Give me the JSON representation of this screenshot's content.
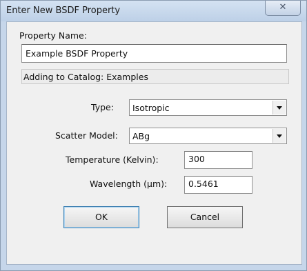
{
  "window": {
    "title": "Enter New BSDF Property",
    "close_glyph": "✕"
  },
  "property_name": {
    "label": "Property Name:",
    "value": "Example BSDF Property"
  },
  "catalog_info": "Adding to Catalog: Examples",
  "type": {
    "label": "Type:",
    "selected": "Isotropic"
  },
  "scatter_model": {
    "label": "Scatter Model:",
    "selected": "ABg"
  },
  "temperature": {
    "label": "Temperature (Kelvin):",
    "value": "300"
  },
  "wavelength": {
    "label": "Wavelength (µm):",
    "value": "0.5461"
  },
  "buttons": {
    "ok": "OK",
    "cancel": "Cancel"
  },
  "icons": {
    "close": "close-icon",
    "dropdown": "chevron-down-icon"
  }
}
